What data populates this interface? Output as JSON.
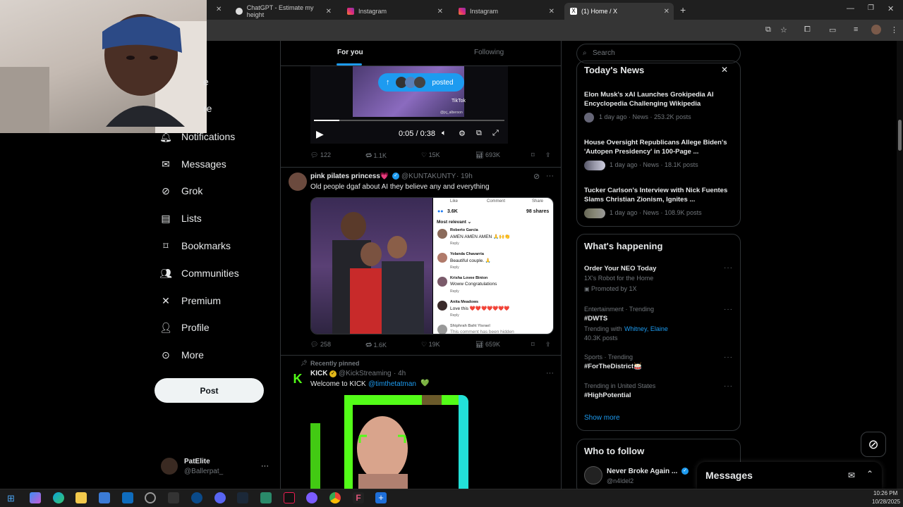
{
  "browser": {
    "tabs": [
      {
        "title": "ChatGPT - Estimate my height",
        "close": "✕"
      },
      {
        "title": "Instagram",
        "close": "✕"
      },
      {
        "title": "Instagram",
        "close": "✕"
      },
      {
        "title": "(1) Home / X",
        "close": "✕"
      }
    ],
    "new_tab": "+"
  },
  "nav": {
    "partial1": "e",
    "partial2": "re",
    "items": [
      "Notifications",
      "Messages",
      "Grok",
      "Lists",
      "Bookmarks",
      "Communities",
      "Premium",
      "Profile",
      "More"
    ],
    "post_label": "Post"
  },
  "account": {
    "name": "PatElite",
    "handle": "@Ballerpat_",
    "more": "···"
  },
  "timeline": {
    "tabs": [
      "For you",
      "Following"
    ],
    "posted_pill": "posted",
    "video": {
      "time": "0:05 / 0:38",
      "tiktok": "TikTok",
      "tiktok_handle": "@jxj_alberson"
    },
    "tweet1_stats": {
      "replies": "122",
      "reposts": "1.1K",
      "likes": "15K",
      "views": "693K"
    },
    "tweet2": {
      "name": "pink pilates princess💗",
      "handle": "@KUNTAKUNTY",
      "time": "· 19h",
      "text": "Old people dgaf about AI they believe any and everything",
      "comments": {
        "top_like": "Like",
        "top_comment": "Comment",
        "top_share": "Share",
        "count": "3.6K",
        "shares": "98 shares",
        "sort": "Most relevant ⌄",
        "list": [
          {
            "name": "Roberto Garcia",
            "text": "AMEN AMEN AMEN 🙏🙌👏"
          },
          {
            "name": "Yolanda Chavarria",
            "text": "Beautiful couple. 🙏"
          },
          {
            "name": "Krisha Lovee Binion",
            "text": "Woww Congratulations"
          },
          {
            "name": "Anita Meadows",
            "text": "Love this ❤️❤️❤️❤️❤️❤️❤️"
          },
          {
            "name": "Shiphrah Baht Yisrael",
            "text": "This comment has been hidden"
          }
        ],
        "reply": "Reply"
      },
      "stats": {
        "replies": "258",
        "reposts": "1.6K",
        "likes": "19K",
        "views": "659K"
      }
    },
    "tweet3": {
      "pinned": "Recently pinned",
      "name": "KICK",
      "handle": "@KickStreaming",
      "time": "· 4h",
      "text": "Welcome to KICK",
      "mention": "@timthetatman",
      "emoji": "💚"
    }
  },
  "sidebar": {
    "search_placeholder": "Search",
    "news_title": "Today's News",
    "news": [
      {
        "headline": "Elon Musk's xAI Launches Grokipedia AI Encyclopedia Challenging Wikipedia",
        "meta": "1 day ago · News · 253.2K posts"
      },
      {
        "headline": "House Oversight Republicans Allege Biden's 'Autopen Presidency' in 100-Page ...",
        "meta": "1 day ago · News · 18.1K posts"
      },
      {
        "headline": "Tucker Carlson's Interview with Nick Fuentes Slams Christian Zionism, Ignites ...",
        "meta": "1 day ago · News · 108.9K posts"
      }
    ],
    "happening_title": "What's happening",
    "happening": [
      {
        "context": "",
        "title": "Order Your NEO Today",
        "sub": "1X's Robot for the Home",
        "extra": "Promoted by 1X"
      },
      {
        "context": "Entertainment · Trending",
        "title": "#DWTS",
        "sub": "Trending with",
        "links": "Whitney, Elaine",
        "extra": "40.3K posts"
      },
      {
        "context": "Sports · Trending",
        "title": "#ForTheDistrict🥁",
        "sub": "",
        "extra": ""
      },
      {
        "context": "Trending in United States",
        "title": "#HighPotential",
        "sub": "",
        "extra": ""
      }
    ],
    "show_more": "Show more",
    "who_title": "Who to follow",
    "who": {
      "name": "Never Broke Again ...",
      "handle": "@n4ldel2"
    }
  },
  "messages_drawer": {
    "title": "Messages"
  },
  "clock": {
    "time": "10:26 PM",
    "date": "10/28/2025"
  },
  "colors": {
    "accent": "#1d9bf0",
    "background": "#000000",
    "border": "#2f3336",
    "muted": "#71767b"
  }
}
